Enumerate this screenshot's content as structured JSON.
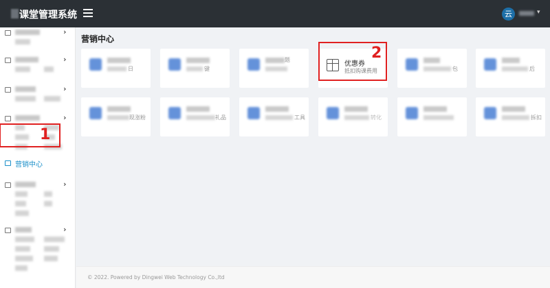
{
  "header": {
    "title": "课堂管理系统",
    "menu_icon": "hamburger-icon",
    "user_avatar_text": "云"
  },
  "sidebar": {
    "active_label": "营销中心",
    "items_icon_names": [
      "folder-icon",
      "building-icon",
      "doc-icon",
      "doc-icon",
      "file-icon",
      "grid-icon",
      "doc-icon"
    ]
  },
  "main": {
    "section_title": "营销中心",
    "cards_row1": [
      {
        "frag": "日"
      },
      {
        "frag": "键"
      },
      {
        "frag_top": "题"
      },
      {
        "title": "优惠券",
        "subtitle": "抵扣购课费用"
      },
      {
        "frag": "包"
      },
      {
        "frag": "后"
      }
    ],
    "cards_row2": [
      {
        "frag": "现涨粉"
      },
      {
        "frag": "礼品"
      },
      {
        "frag": "工具"
      },
      {
        "frag": "转化"
      },
      {
        "frag": ""
      },
      {
        "frag": "拆扣"
      }
    ]
  },
  "annotations": {
    "marker_1": "1",
    "marker_2": "2"
  },
  "footer": {
    "text": "© 2022. Powered by Dingwei Web Technology Co.,ltd"
  },
  "colors": {
    "topbar": "#2b3035",
    "accent": "#1a8fc9",
    "card_icon": "#4a7fd4",
    "marker": "#e02020"
  }
}
